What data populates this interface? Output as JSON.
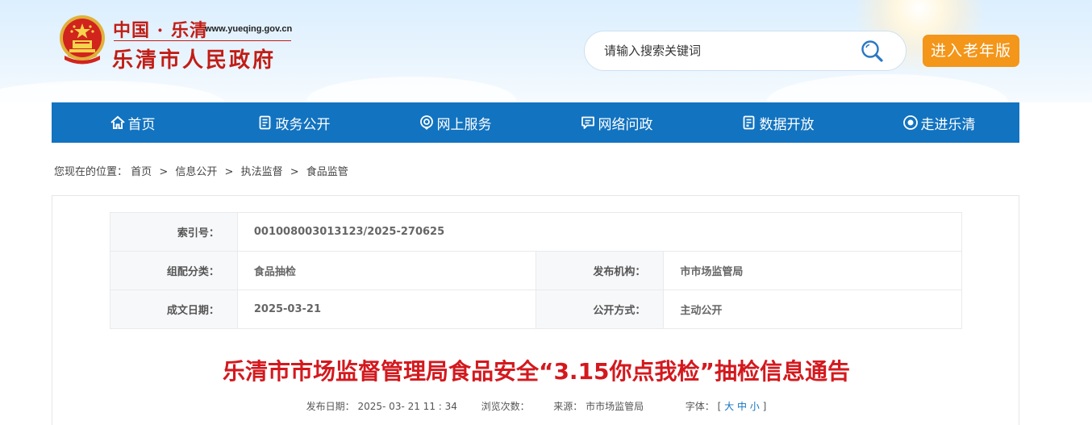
{
  "header": {
    "site_cn": "中国 · 乐清",
    "site_url": "www.yueqing.gov.cn",
    "site_name": "乐清市人民政府",
    "search_placeholder": "请输入搜索关键词",
    "elder_button": "进入老年版",
    "colors": {
      "brand_red": "#c11d16",
      "elder_orange": "#f39619"
    }
  },
  "nav": {
    "color": "#1273c0",
    "items": [
      {
        "label": "首页",
        "icon": "home-icon"
      },
      {
        "label": "政务公开",
        "icon": "document-icon"
      },
      {
        "label": "网上服务",
        "icon": "location-icon"
      },
      {
        "label": "网络问政",
        "icon": "chat-icon"
      },
      {
        "label": "数据开放",
        "icon": "data-icon"
      },
      {
        "label": "走进乐清",
        "icon": "eye-icon"
      }
    ]
  },
  "breadcrumb": {
    "prefix": "您现在的位置：",
    "items": [
      "首页",
      "信息公开",
      "执法监督",
      "食品监管"
    ]
  },
  "meta": {
    "index_label": "索引号：",
    "index_value": "001008003013123/2025-270625",
    "category_label": "组配分类：",
    "category_value": "食品抽检",
    "publisher_label": "发布机构：",
    "publisher_value": "市市场监管局",
    "date_label": "成文日期：",
    "date_value": "2025-03-21",
    "mode_label": "公开方式：",
    "mode_value": "主动公开"
  },
  "article": {
    "title": "乐清市市场监督管理局食品安全“3.15你点我检”抽检信息通告",
    "title_color": "#d3191e",
    "publish_label": "发布日期：",
    "publish_value": "2025- 03- 21 11 : 34",
    "views_label": "浏览次数：",
    "source_label": "来源：",
    "source_value": "市市场监管局",
    "font_label": "字体：",
    "font_open": "[",
    "font_large": "大",
    "font_medium": "中",
    "font_small": "小",
    "font_close": "]"
  }
}
